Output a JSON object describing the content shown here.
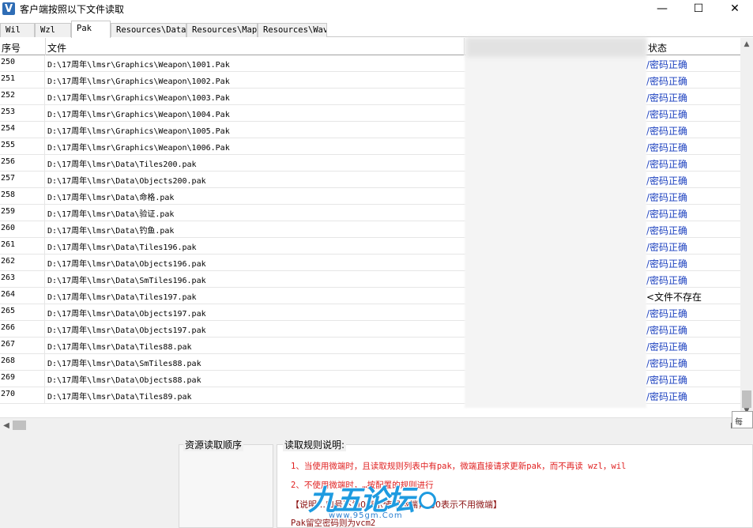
{
  "window": {
    "icon_letter": "V",
    "title": "客户端按照以下文件读取",
    "minimize_glyph": "—",
    "maximize_glyph": "☐",
    "close_glyph": "✕"
  },
  "tabs": [
    {
      "label": "Wil",
      "active": false
    },
    {
      "label": "Wzl",
      "active": false
    },
    {
      "label": "Pak",
      "active": true
    },
    {
      "label": "Resources\\Data",
      "active": false
    },
    {
      "label": "Resources\\Map",
      "active": false
    },
    {
      "label": "Resources\\Wav",
      "active": false
    }
  ],
  "table": {
    "headers": {
      "no": "序号",
      "file": "文件",
      "status": "状态"
    },
    "rows": [
      {
        "no": "250",
        "file": "D:\\17周年\\lmsr\\Graphics\\Weapon\\1001.Pak",
        "status": "/密码正确",
        "ok": true
      },
      {
        "no": "251",
        "file": "D:\\17周年\\lmsr\\Graphics\\Weapon\\1002.Pak",
        "status": "/密码正确",
        "ok": true
      },
      {
        "no": "252",
        "file": "D:\\17周年\\lmsr\\Graphics\\Weapon\\1003.Pak",
        "status": "/密码正确",
        "ok": true
      },
      {
        "no": "253",
        "file": "D:\\17周年\\lmsr\\Graphics\\Weapon\\1004.Pak",
        "status": "/密码正确",
        "ok": true
      },
      {
        "no": "254",
        "file": "D:\\17周年\\lmsr\\Graphics\\Weapon\\1005.Pak",
        "status": "/密码正确",
        "ok": true
      },
      {
        "no": "255",
        "file": "D:\\17周年\\lmsr\\Graphics\\Weapon\\1006.Pak",
        "status": "/密码正确",
        "ok": true
      },
      {
        "no": "256",
        "file": "D:\\17周年\\lmsr\\Data\\Tiles200.pak",
        "status": "/密码正确",
        "ok": true
      },
      {
        "no": "257",
        "file": "D:\\17周年\\lmsr\\Data\\Objects200.pak",
        "status": "/密码正确",
        "ok": true
      },
      {
        "no": "258",
        "file": "D:\\17周年\\lmsr\\Data\\命格.pak",
        "status": "/密码正确",
        "ok": true
      },
      {
        "no": "259",
        "file": "D:\\17周年\\lmsr\\Data\\验证.pak",
        "status": "/密码正确",
        "ok": true
      },
      {
        "no": "260",
        "file": "D:\\17周年\\lmsr\\Data\\钓鱼.pak",
        "status": "/密码正确",
        "ok": true
      },
      {
        "no": "261",
        "file": "D:\\17周年\\lmsr\\Data\\Tiles196.pak",
        "status": "/密码正确",
        "ok": true
      },
      {
        "no": "262",
        "file": "D:\\17周年\\lmsr\\Data\\Objects196.pak",
        "status": "/密码正确",
        "ok": true
      },
      {
        "no": "263",
        "file": "D:\\17周年\\lmsr\\Data\\SmTiles196.pak",
        "status": "/密码正确",
        "ok": true
      },
      {
        "no": "264",
        "file": "D:\\17周年\\lmsr\\Data\\Tiles197.pak",
        "status": "<文件不存在",
        "ok": false
      },
      {
        "no": "265",
        "file": "D:\\17周年\\lmsr\\Data\\Objects197.pak",
        "status": "/密码正确",
        "ok": true
      },
      {
        "no": "266",
        "file": "D:\\17周年\\lmsr\\Data\\Objects197.pak",
        "status": "/密码正确",
        "ok": true
      },
      {
        "no": "267",
        "file": "D:\\17周年\\lmsr\\Data\\Tiles88.pak",
        "status": "/密码正确",
        "ok": true
      },
      {
        "no": "268",
        "file": "D:\\17周年\\lmsr\\Data\\SmTiles88.pak",
        "status": "/密码正确",
        "ok": true
      },
      {
        "no": "269",
        "file": "D:\\17周年\\lmsr\\Data\\Objects88.pak",
        "status": "/密码正确",
        "ok": true
      },
      {
        "no": "270",
        "file": "D:\\17周年\\lmsr\\Data\\Tiles89.pak",
        "status": "/密码正确",
        "ok": true
      }
    ]
  },
  "scrollbars": {
    "up_glyph": "▲",
    "down_glyph": "▼",
    "left_glyph": "◀",
    "right_glyph": "▶"
  },
  "corner_tip": "每",
  "bottom": {
    "order_title": "资源读取顺序",
    "rules_title": "读取规则说明:",
    "rules": [
      "1、当使用微端时，且读取规则列表中有pak，微端直接请求更新pak，而不再读 wzl，wil",
      "2、不使用微端时，…按配置的规则进行",
      "【说明…口号不为0表示使用微端，为0表示不用微端】",
      "Pak留空密码则为vcm2"
    ]
  },
  "watermark": {
    "text": "九五论坛",
    "sub": "www.95gm.Com"
  }
}
